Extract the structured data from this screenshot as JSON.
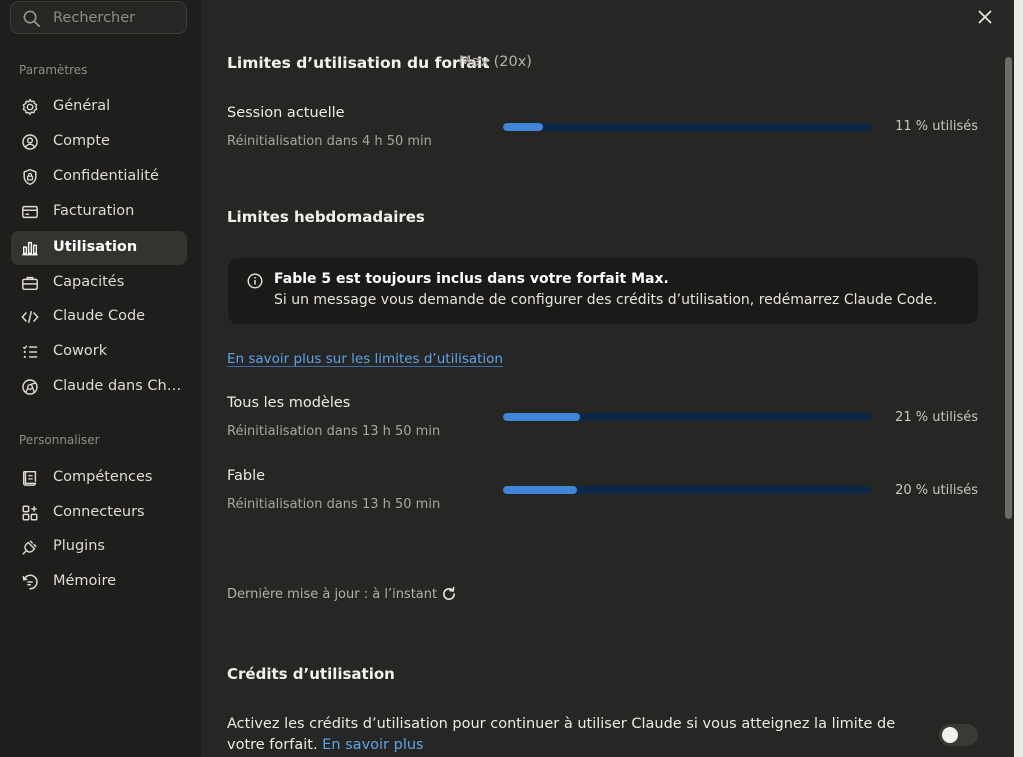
{
  "search": {
    "placeholder": "Rechercher"
  },
  "sidebar": {
    "section_settings": "Paramètres",
    "section_personalize": "Personnaliser",
    "items": [
      {
        "label": "Général",
        "icon": "gear-icon"
      },
      {
        "label": "Compte",
        "icon": "account-icon"
      },
      {
        "label": "Confidentialité",
        "icon": "shield-lock-icon"
      },
      {
        "label": "Facturation",
        "icon": "credit-card-icon"
      },
      {
        "label": "Utilisation",
        "icon": "bar-chart-icon",
        "active": true
      },
      {
        "label": "Capacités",
        "icon": "briefcase-icon"
      },
      {
        "label": "Claude Code",
        "icon": "code-icon"
      },
      {
        "label": "Cowork",
        "icon": "checklist-icon"
      },
      {
        "label": "Claude dans Ch…",
        "icon": "globe-icon"
      }
    ],
    "items2": [
      {
        "label": "Compétences",
        "icon": "scroll-icon"
      },
      {
        "label": "Connecteurs",
        "icon": "connectors-icon"
      },
      {
        "label": "Plugins",
        "icon": "plug-icon"
      },
      {
        "label": "Mémoire",
        "icon": "memory-icon"
      }
    ]
  },
  "main": {
    "plan_title": "Limites d’utilisation du forfait",
    "plan_tag": "Max (20x)",
    "session": {
      "label": "Session actuelle",
      "reset": "Réinitialisation dans 4 h 50 min",
      "percent_text": "11 % utilisés",
      "fraction": 0.11
    },
    "weekly_title": "Limites hebdomadaires",
    "notice": {
      "title": "Fable 5 est toujours inclus dans votre forfait Max.",
      "body": "Si un message vous demande de configurer des crédits d’utilisation, redémarrez Claude Code."
    },
    "learn_more_limits": "En savoir plus sur les limites d’utilisation",
    "all_models": {
      "label": "Tous les modèles",
      "reset": "Réinitialisation dans 13 h 50 min",
      "percent_text": "21 % utilisés",
      "fraction": 0.21
    },
    "fable": {
      "label": "Fable",
      "reset": "Réinitialisation dans 13 h 50 min",
      "percent_text": "20 % utilisés",
      "fraction": 0.2
    },
    "last_updated": "Dernière mise à jour : à l’instant",
    "credits_title": "Crédits d’utilisation",
    "credits_text": "Activez les crédits d’utilisation pour continuer à utiliser Claude si vous atteignez la limite de votre forfait.",
    "credits_link": "En savoir plus",
    "credits_toggle_on": false
  },
  "colors": {
    "accent": "#3f86d8",
    "bar_track": "#0d2847",
    "link": "#5ea3ea",
    "sidebar_bg": "#1f1e1c",
    "main_bg": "#262624"
  }
}
